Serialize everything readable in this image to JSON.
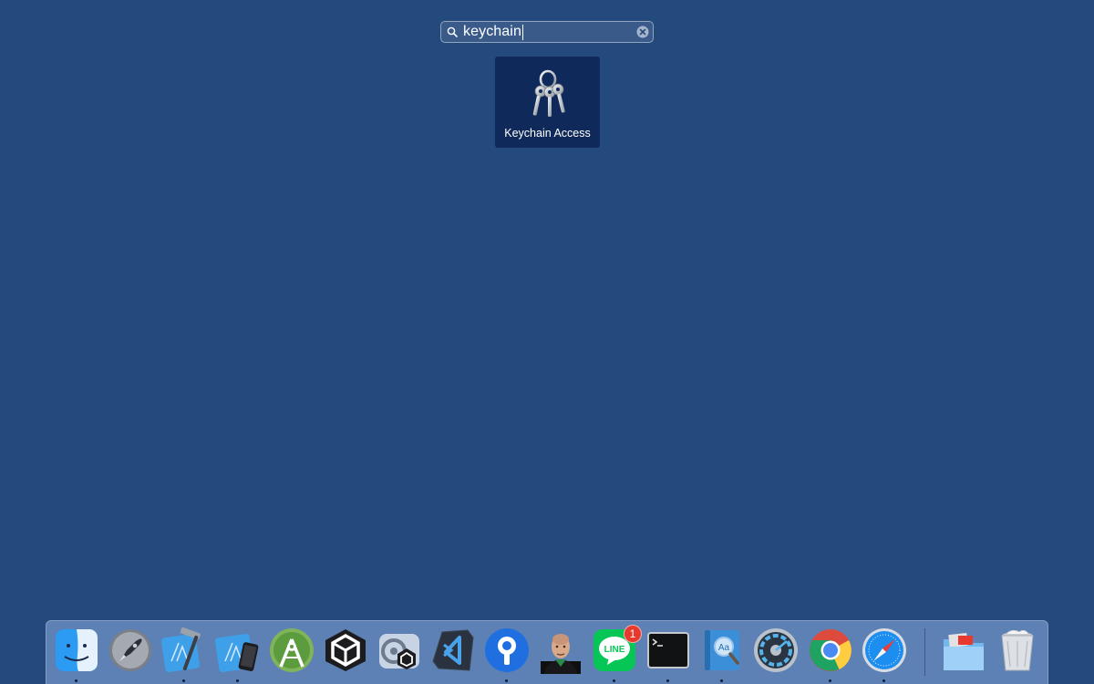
{
  "search": {
    "query": "keychain"
  },
  "result": {
    "label": "Keychain Access"
  },
  "dock": {
    "apps": [
      {
        "name": "Finder",
        "icon": "finder-icon",
        "running": true
      },
      {
        "name": "Launchpad",
        "icon": "launchpad-icon",
        "running": false
      },
      {
        "name": "Xcode",
        "icon": "xcode-icon",
        "running": true
      },
      {
        "name": "Simulator",
        "icon": "simulator-icon",
        "running": true
      },
      {
        "name": "Android Studio",
        "icon": "android-studio-icon",
        "running": false
      },
      {
        "name": "Unity",
        "icon": "unity-icon",
        "running": false
      },
      {
        "name": "Unity Hub",
        "icon": "unity-hub-icon",
        "running": false
      },
      {
        "name": "Visual Studio Code",
        "icon": "vscode-icon",
        "running": false
      },
      {
        "name": "Sourcetree",
        "icon": "sourcetree-icon",
        "running": true
      },
      {
        "name": "Profile",
        "icon": "profile-photo-icon",
        "running": false
      },
      {
        "name": "LINE",
        "icon": "line-icon",
        "running": true,
        "badge": "1"
      },
      {
        "name": "Terminal",
        "icon": "terminal-icon",
        "running": true
      },
      {
        "name": "Dictionary",
        "icon": "dictionary-icon",
        "running": true
      },
      {
        "name": "Disk Utility",
        "icon": "disk-utility-icon",
        "running": false
      },
      {
        "name": "Google Chrome",
        "icon": "chrome-icon",
        "running": true
      },
      {
        "name": "Safari",
        "icon": "safari-icon",
        "running": true
      }
    ],
    "stacks": [
      {
        "name": "Downloads",
        "icon": "folder-icon"
      },
      {
        "name": "Trash",
        "icon": "trash-icon"
      }
    ],
    "line_badge": "1"
  },
  "colors": {
    "background": "#24497c",
    "result_tile": "#0f2a5a",
    "badge": "#e8392e"
  }
}
